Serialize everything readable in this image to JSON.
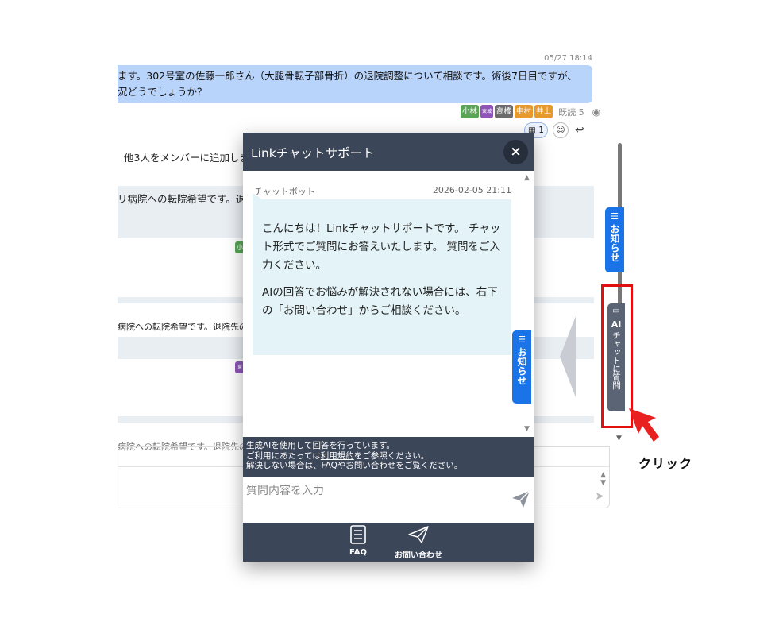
{
  "background_chat": {
    "timestamp": "05/27 18:14",
    "message_1_line1": "ます。302号室の佐藤一郎さん（大腿骨転子部骨折）の退院調整について相談です。術後7日目ですが、",
    "message_1_line2": "況どうでしょうか？",
    "readers": [
      {
        "name": "小林",
        "color": "#5aa457"
      },
      {
        "name": "東城",
        "color": "#8e55b8"
      },
      {
        "name": "高橋",
        "color": "#6b6b6b"
      },
      {
        "name": "中村",
        "color": "#e69a2e"
      },
      {
        "name": "井上",
        "color": "#e69a2e"
      }
    ],
    "read_count": "既読 5",
    "reaction_count": "1",
    "system_text": "他3人をメンバーに追加しま",
    "message_2": "リ病院への転院希望です。退",
    "message_3": "病院への転院希望です。退院先の",
    "message_4": "病院への転院希望です。退院先の",
    "chip_small_1": "小",
    "chip_small_2": "東"
  },
  "side_notice_tab": {
    "label": "お知らせ"
  },
  "ai_tab": {
    "ai": "AI",
    "label": "チャットに質問"
  },
  "annotation": {
    "click_label": "クリック",
    "highlight_color": "#e01010"
  },
  "popup": {
    "title": "Linkチャットサポート",
    "close_label": "×",
    "sender": "チャットボット",
    "timestamp": "2026-02-05 21:11",
    "message_p1": "こんにちは！Linkチャットサポートです。 チャット形式でご質問にお答えいたします。 質問をご入力ください。",
    "message_p2": "AIの回答でお悩みが解決されない場合には、右下の「お問い合わせ」からご相談ください。",
    "notice_label": "お知らせ",
    "disclaimer_line1": "生成AIを使用して回答を行っています。",
    "disclaimer_line2_pre": "ご利用にあたっては",
    "disclaimer_line2_link": "利用規約",
    "disclaimer_line2_post": "をご参照ください。",
    "disclaimer_line3": "解決しない場合は、FAQやお問い合わせをご覧ください。",
    "input_placeholder": "質問内容を入力",
    "footer": {
      "faq_label": "FAQ",
      "contact_label": "お問い合わせ"
    }
  },
  "colors": {
    "header_bg": "#3c4659",
    "accent_blue": "#1a74e8",
    "bubble_bg": "#e3f3f7",
    "user_bubble": "#b9d4fb"
  }
}
